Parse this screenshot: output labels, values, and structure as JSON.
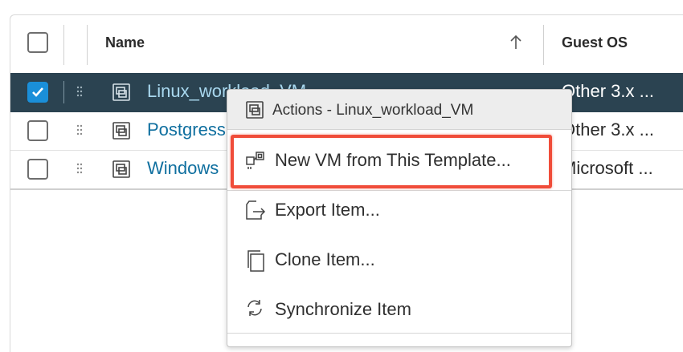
{
  "columns": {
    "name": "Name",
    "guest_os": "Guest OS"
  },
  "rows": [
    {
      "name": "Linux_workload_VM",
      "guest_os": "Other 3.x ...",
      "selected": true
    },
    {
      "name": "Postgress",
      "guest_os": "Other 3.x ...",
      "selected": false
    },
    {
      "name": "Windows",
      "guest_os": "Microsoft ...",
      "selected": false
    }
  ],
  "context_menu": {
    "title": "Actions - Linux_workload_VM",
    "items": [
      {
        "label": "New VM from This Template...",
        "icon": "new-vm-icon",
        "highlighted": true
      },
      {
        "label": "Export Item...",
        "icon": "export-icon"
      },
      {
        "label": "Clone Item...",
        "icon": "clone-icon"
      },
      {
        "label": "Synchronize Item",
        "icon": "sync-icon"
      }
    ]
  },
  "colors": {
    "selected_row": "#2b4351",
    "checkbox_checked": "#1a8fd9",
    "link": "#0f6f9f",
    "highlight_border": "#f04d3a"
  }
}
